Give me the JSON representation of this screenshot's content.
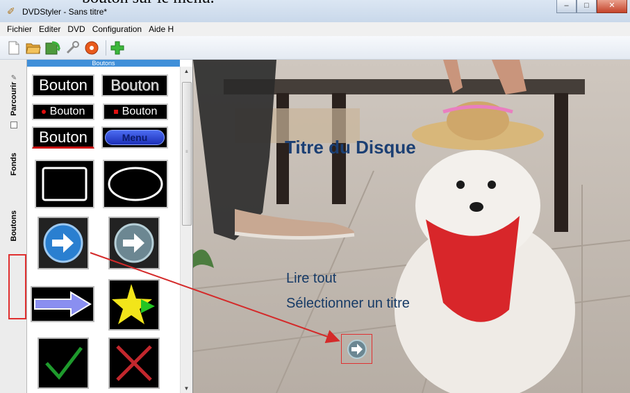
{
  "caption": "bouton sur le menu.",
  "window": {
    "title": "DVDStyler - Sans titre*",
    "buttons": {
      "minimize": "–",
      "maximize": "□",
      "close": "✕"
    }
  },
  "menubar": [
    "Fichier",
    "Editer",
    "DVD",
    "Configuration",
    "Aide H"
  ],
  "toolbar": {
    "icons": [
      "new-icon",
      "open-icon",
      "save-icon",
      "settings-wrench-icon",
      "burn-disc-icon",
      "add-icon"
    ]
  },
  "sidetabs": {
    "tab1": "Parcourir",
    "tab2": "Fonds",
    "tab3": "Boutons",
    "selected": "Boutons"
  },
  "panel": {
    "header": "Boutons",
    "thumbs": {
      "t1": "Bouton",
      "t2": "Bouton",
      "t3": "Bouton",
      "t4": "Bouton",
      "t5": "Bouton",
      "t6": "Menu"
    }
  },
  "canvas": {
    "title": "Titre du Disque",
    "items": [
      "Lire tout",
      "Sélectionner un titre"
    ]
  },
  "colors": {
    "selection_border": "#e03030",
    "panel_header": "#3f8fd9",
    "menu_text": "#163a66"
  }
}
